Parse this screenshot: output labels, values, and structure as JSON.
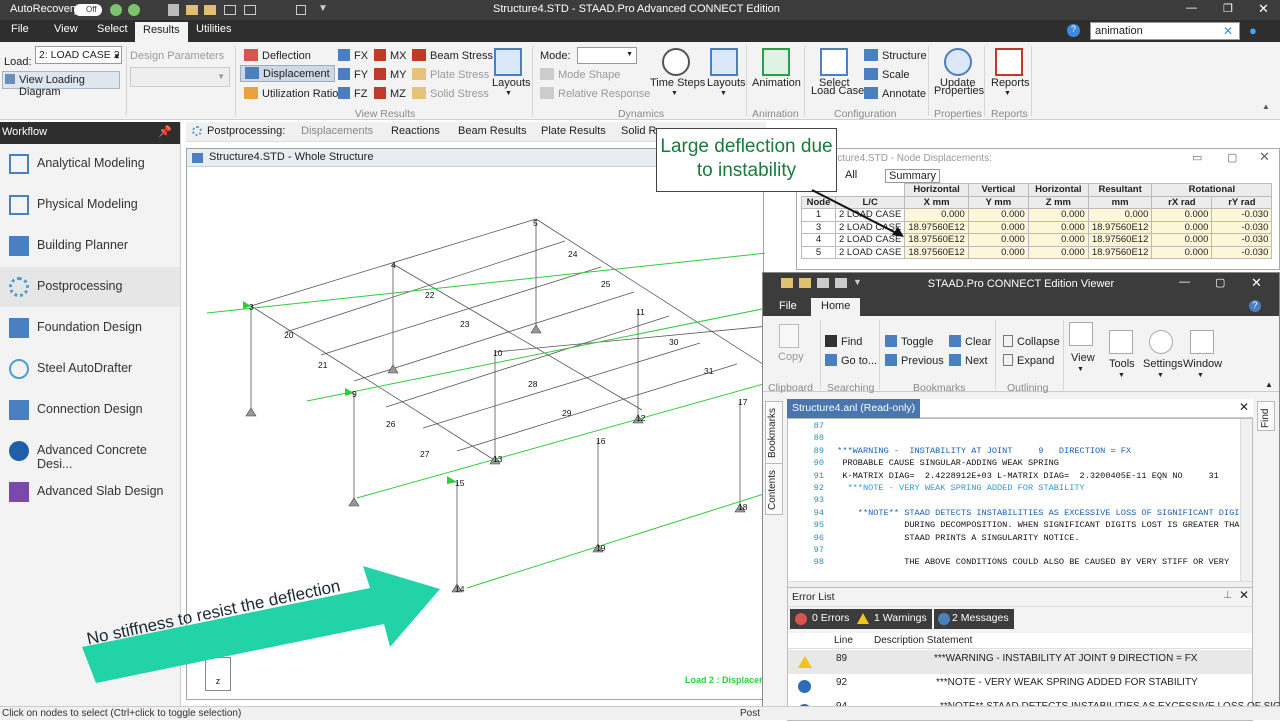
{
  "titlebar": {
    "autorecovery": "AutoRecovery",
    "toggle_state": "Off",
    "title": "Structure4.STD - STAAD.Pro Advanced CONNECT Edition"
  },
  "menubar": {
    "items": [
      "File",
      "View",
      "Select",
      "Results",
      "Utilities"
    ],
    "active": "Results",
    "search_value": "animation"
  },
  "ribbon": {
    "load_label": "Load:",
    "load_value": "2: LOAD CASE 2",
    "view_loading_diagram": "View Loading Diagram",
    "design_parameters": "Design Parameters",
    "view_results": {
      "deflection": "Deflection",
      "displacement": "Displacement",
      "utilization_ratio": "Utilization Ratio",
      "fx": "FX",
      "fy": "FY",
      "fz": "FZ",
      "mx": "MX",
      "my": "MY",
      "mz": "MZ",
      "beam_stress": "Beam Stress",
      "plate_stress": "Plate Stress",
      "solid_stress": "Solid Stress",
      "layouts": "Layouts",
      "group": "View Results"
    },
    "dynamics": {
      "mode_label": "Mode:",
      "mode_shape": "Mode Shape",
      "relative_response": "Relative Response",
      "time_steps": "Time Steps",
      "layouts": "Layouts",
      "group": "Dynamics"
    },
    "animation": {
      "label": "Animation",
      "group": "Animation"
    },
    "configuration": {
      "select_load_case_1": "Select",
      "select_load_case_2": "Load Case",
      "structure": "Structure",
      "scale": "Scale",
      "annotate": "Annotate",
      "group": "Configuration"
    },
    "properties": {
      "update_1": "Update",
      "update_2": "Properties",
      "group": "Properties"
    },
    "reports": {
      "label": "Reports",
      "group": "Reports"
    }
  },
  "workflow": {
    "header": "Workflow",
    "items": [
      "Analytical Modeling",
      "Physical Modeling",
      "Building Planner",
      "Postprocessing",
      "Foundation Design",
      "Steel AutoDrafter",
      "Connection Design",
      "Advanced Concrete Desi...",
      "Advanced Slab Design"
    ],
    "active": "Postprocessing"
  },
  "page_tabs": {
    "prefix": "Postprocessing:",
    "tabs": [
      "Displacements",
      "Reactions",
      "Beam Results",
      "Plate Results",
      "Solid Re"
    ],
    "active": "Displacements"
  },
  "viewport": {
    "title": "Structure4.STD - Whole Structure",
    "load_caption": "Load 2 : Displacer",
    "nodes": [
      "3",
      "4",
      "5",
      "9",
      "10",
      "11",
      "12",
      "13",
      "14",
      "15",
      "16",
      "17",
      "18",
      "19",
      "20",
      "21",
      "22",
      "23",
      "24",
      "25",
      "26",
      "27",
      "28",
      "29",
      "30",
      "31"
    ]
  },
  "annotations": {
    "callout": "Large deflection due to instability",
    "arrow_text": "No stiffness to resist the deflection"
  },
  "node_displacements": {
    "title": "Structure4.STD - Node Displacements:",
    "tabs": [
      "All",
      "Summary"
    ],
    "header_groups": [
      "Horizontal",
      "Vertical",
      "Horizontal",
      "Resultant",
      "Rotational"
    ],
    "columns": [
      "Node",
      "L/C",
      "X mm",
      "Y mm",
      "Z mm",
      "mm",
      "rX rad",
      "rY rad"
    ],
    "rows": [
      [
        "1",
        "2 LOAD CASE",
        "0.000",
        "0.000",
        "0.000",
        "0.000",
        "0.000",
        "-0.030"
      ],
      [
        "3",
        "2 LOAD CASE",
        "18.97560E12",
        "0.000",
        "0.000",
        "18.97560E12",
        "0.000",
        "-0.030"
      ],
      [
        "4",
        "2 LOAD CASE",
        "18.97560E12",
        "0.000",
        "0.000",
        "18.97560E12",
        "0.000",
        "-0.030"
      ],
      [
        "5",
        "2 LOAD CASE",
        "18.97560E12",
        "0.000",
        "0.000",
        "18.97560E12",
        "0.000",
        "-0.030"
      ]
    ]
  },
  "viewer": {
    "title": "STAAD.Pro CONNECT Edition Viewer",
    "tabs": [
      "File",
      "Home"
    ],
    "active_tab": "Home",
    "ribbon": {
      "copy": "Copy",
      "clipboard": "Clipboard",
      "find": "Find",
      "goto": "Go to...",
      "searching": "Searching",
      "toggle": "Toggle",
      "previous": "Previous",
      "clear": "Clear",
      "next": "Next",
      "bookmarks": "Bookmarks",
      "collapse": "Collapse",
      "expand": "Expand",
      "outlining": "Outlining",
      "view": "View",
      "tools": "Tools",
      "settings": "Settings",
      "window": "Window"
    },
    "side_tabs": [
      "Bookmarks",
      "Contents"
    ],
    "find_tab": "Find",
    "doc_tab": "Structure4.anl (Read-only)",
    "code_lines": [
      {
        "n": "87",
        "t": ""
      },
      {
        "n": "88",
        "t": ""
      },
      {
        "n": "89",
        "t": " ***WARNING -  INSTABILITY AT JOINT     9   DIRECTION = FX"
      },
      {
        "n": "90",
        "t": "  PROBABLE CAUSE SINGULAR-ADDING WEAK SPRING"
      },
      {
        "n": "91",
        "t": "  K-MATRIX DIAG=  2.4228912E+03 L-MATRIX DIAG=  2.3200405E-11 EQN NO     31"
      },
      {
        "n": "92",
        "t": "   ***NOTE - VERY WEAK SPRING ADDED FOR STABILITY"
      },
      {
        "n": "93",
        "t": ""
      },
      {
        "n": "94",
        "t": "     **NOTE** STAAD DETECTS INSTABILITIES AS EXCESSIVE LOSS OF SIGNIFICANT DIGI"
      },
      {
        "n": "95",
        "t": "              DURING DECOMPOSITION. WHEN SIGNIFICANT DIGITS LOST IS GREATER THA"
      },
      {
        "n": "96",
        "t": "              STAAD PRINTS A SINGULARITY NOTICE."
      },
      {
        "n": "97",
        "t": ""
      },
      {
        "n": "98",
        "t": "              THE ABOVE CONDITIONS COULD ALSO BE CAUSED BY VERY STIFF OR VERY"
      }
    ],
    "error_list": {
      "title": "Error List",
      "errors": "0 Errors",
      "warnings": "1 Warnings",
      "messages": "2 Messages",
      "col_line": "Line",
      "col_desc": "Description Statement",
      "rows": [
        {
          "type": "warning",
          "line": "89",
          "desc": "***WARNING -  INSTABILITY AT JOINT     9   DIRECTION = FX"
        },
        {
          "type": "info",
          "line": "92",
          "desc": "***NOTE - VERY WEAK SPRING ADDED FOR STABILITY"
        },
        {
          "type": "info",
          "line": "94",
          "desc": "**NOTE** STAAD DETECTS INSTABILITIES AS EXCESSIVE LOSS OF SIGN"
        }
      ]
    }
  },
  "statusbar": {
    "hint": "Click on nodes to select (Ctrl+click to toggle selection)",
    "right": "Post"
  },
  "colors": {
    "load_green": "#2ecc40",
    "callout_green": "#1a7a3a",
    "arrow_teal": "#22d3a8",
    "dark_bar": "#2e2e2e"
  }
}
